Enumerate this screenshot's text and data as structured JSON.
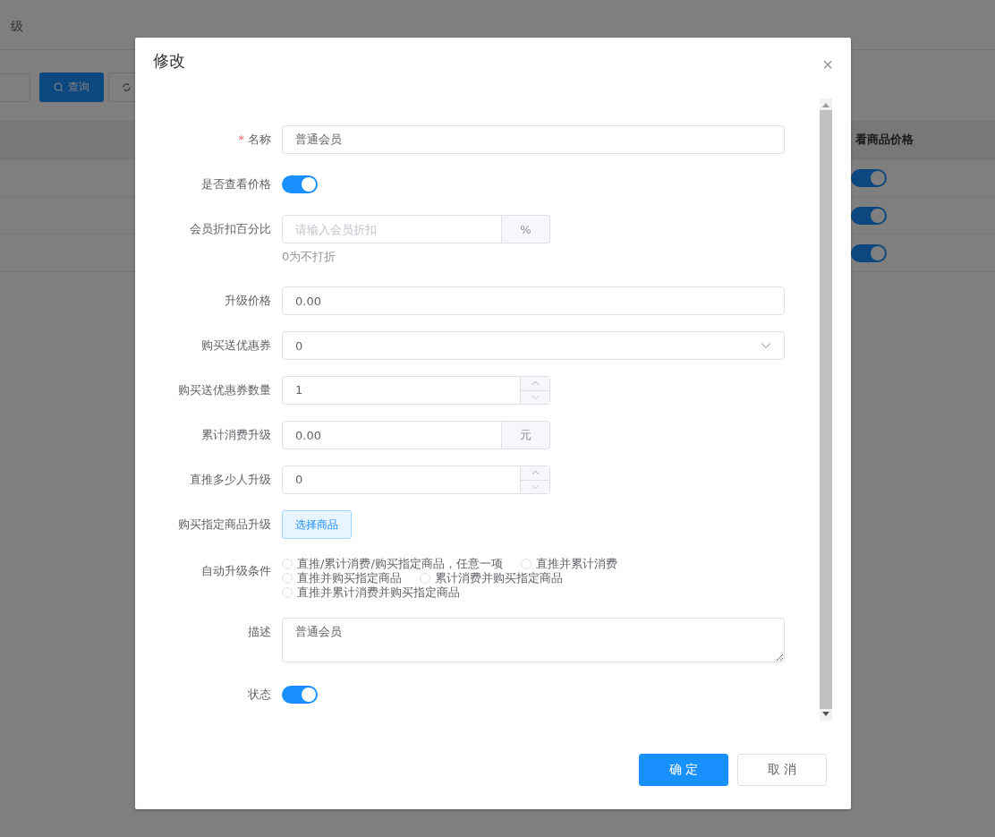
{
  "page": {
    "title": "级",
    "search_button": "查询",
    "table": {
      "column": "看商品价格",
      "rows": [
        {
          "show_price": true
        },
        {
          "show_price": true
        },
        {
          "show_price": true
        }
      ]
    }
  },
  "dialog": {
    "title": "修改",
    "close": "×",
    "fields": [
      {
        "kind": "text",
        "label": "名称",
        "required_mark": "*",
        "value": "普通会员"
      },
      {
        "kind": "switch",
        "label": "是否查看价格",
        "on": true
      },
      {
        "kind": "addon",
        "label": "会员折扣百分比",
        "placeholder": "请输入会员折扣",
        "addon": "%",
        "hint": "0为不打折"
      },
      {
        "kind": "text",
        "label": "升级价格",
        "value": "0.00"
      },
      {
        "kind": "select",
        "label": "购买送优惠券",
        "value": "0"
      },
      {
        "kind": "number",
        "label": "购买送优惠券数量",
        "value": "1"
      },
      {
        "kind": "addon",
        "label": "累计消费升级",
        "value": "0.00",
        "addon": "元"
      },
      {
        "kind": "number",
        "label": "直推多少人升级",
        "value": "0"
      },
      {
        "kind": "button",
        "label": "购买指定商品升级",
        "button": "选择商品"
      },
      {
        "kind": "radio",
        "label": "自动升级条件",
        "options": [
          {
            "label": "直推/累计消费/购买指定商品，任意一项",
            "selected": false
          },
          {
            "label": "直推并累计消费",
            "selected": false
          },
          {
            "label": "直推并购买指定商品",
            "selected": false
          },
          {
            "label": "累计消费并购买指定商品",
            "selected": false
          },
          {
            "label": "直推并累计消费并购买指定商品",
            "selected": false
          }
        ]
      },
      {
        "kind": "textarea",
        "label": "描述",
        "value": "普通会员"
      },
      {
        "kind": "switch",
        "label": "状态",
        "on": true
      }
    ],
    "buttons": [
      {
        "label": "确 定",
        "primary": true
      },
      {
        "label": "取 消",
        "primary": false
      }
    ]
  }
}
